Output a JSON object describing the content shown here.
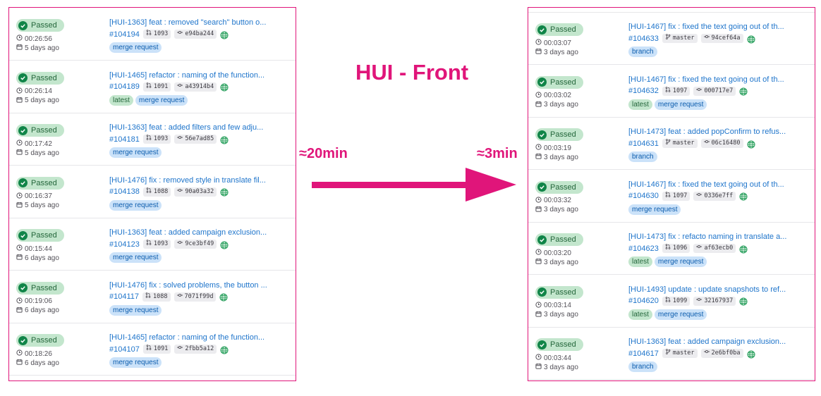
{
  "heading": "HUI - Front",
  "left_time_label": "≈20min",
  "right_time_label": "≈3min",
  "colors": {
    "accent": "#e0157a",
    "passed_bg": "#c3e6cd",
    "passed_text": "#24663b",
    "link": "#1f75cb"
  },
  "left_pipelines": [
    {
      "status": "Passed",
      "duration": "00:26:56",
      "age": "5 days ago",
      "title": "[HUI-1363] feat : removed \"search\" button o...",
      "id": "#104194",
      "ref_icon": "merge-request-icon",
      "ref": "1093",
      "commit": "e94ba244",
      "tags": [
        "merge request"
      ]
    },
    {
      "status": "Passed",
      "duration": "00:26:14",
      "age": "5 days ago",
      "title": "[HUI-1465] refactor : naming of the function...",
      "id": "#104189",
      "ref_icon": "merge-request-icon",
      "ref": "1091",
      "commit": "a43914b4",
      "tags": [
        "latest",
        "merge request"
      ]
    },
    {
      "status": "Passed",
      "duration": "00:17:42",
      "age": "5 days ago",
      "title": "[HUI-1363] feat : added filters and few adju...",
      "id": "#104181",
      "ref_icon": "merge-request-icon",
      "ref": "1093",
      "commit": "56e7ad85",
      "tags": [
        "merge request"
      ]
    },
    {
      "status": "Passed",
      "duration": "00:16:37",
      "age": "5 days ago",
      "title": "[HUI-1476] fix : removed style in translate fil...",
      "id": "#104138",
      "ref_icon": "merge-request-icon",
      "ref": "1088",
      "commit": "90a03a32",
      "tags": [
        "merge request"
      ]
    },
    {
      "status": "Passed",
      "duration": "00:15:44",
      "age": "6 days ago",
      "title": "[HUI-1363] feat : added campaign exclusion...",
      "id": "#104123",
      "ref_icon": "merge-request-icon",
      "ref": "1093",
      "commit": "9ce3bf49",
      "tags": [
        "merge request"
      ]
    },
    {
      "status": "Passed",
      "duration": "00:19:06",
      "age": "6 days ago",
      "title": "[HUI-1476] fix : solved problems, the button ...",
      "id": "#104117",
      "ref_icon": "merge-request-icon",
      "ref": "1088",
      "commit": "7071f99d",
      "tags": [
        "merge request"
      ]
    },
    {
      "status": "Passed",
      "duration": "00:18:26",
      "age": "6 days ago",
      "title": "[HUI-1465] refactor : naming of the function...",
      "id": "#104107",
      "ref_icon": "merge-request-icon",
      "ref": "1091",
      "commit": "2fbb5a12",
      "tags": [
        "merge request"
      ]
    }
  ],
  "right_pipelines": [
    {
      "status": "Passed",
      "duration": "00:03:07",
      "age": "3 days ago",
      "title": "[HUI-1467] fix : fixed the text going out of th...",
      "id": "#104633",
      "ref_icon": "branch-icon",
      "ref": "master",
      "commit": "94cef64a",
      "tags": [
        "branch"
      ]
    },
    {
      "status": "Passed",
      "duration": "00:03:02",
      "age": "3 days ago",
      "title": "[HUI-1467] fix : fixed the text going out of th...",
      "id": "#104632",
      "ref_icon": "merge-request-icon",
      "ref": "1097",
      "commit": "000717e7",
      "tags": [
        "latest",
        "merge request"
      ]
    },
    {
      "status": "Passed",
      "duration": "00:03:19",
      "age": "3 days ago",
      "title": "[HUI-1473] feat : added popConfirm to refus...",
      "id": "#104631",
      "ref_icon": "branch-icon",
      "ref": "master",
      "commit": "06c16480",
      "tags": [
        "branch"
      ]
    },
    {
      "status": "Passed",
      "duration": "00:03:32",
      "age": "3 days ago",
      "title": "[HUI-1467] fix : fixed the text going out of th...",
      "id": "#104630",
      "ref_icon": "merge-request-icon",
      "ref": "1097",
      "commit": "0336e7ff",
      "tags": [
        "merge request"
      ]
    },
    {
      "status": "Passed",
      "duration": "00:03:20",
      "age": "3 days ago",
      "title": "[HUI-1473] fix : refacto naming in translate a...",
      "id": "#104623",
      "ref_icon": "merge-request-icon",
      "ref": "1096",
      "commit": "af63ecb0",
      "tags": [
        "latest",
        "merge request"
      ]
    },
    {
      "status": "Passed",
      "duration": "00:03:14",
      "age": "3 days ago",
      "title": "[HUI-1493] update : update snapshots to ref...",
      "id": "#104620",
      "ref_icon": "merge-request-icon",
      "ref": "1099",
      "commit": "32167937",
      "tags": [
        "latest",
        "merge request"
      ]
    },
    {
      "status": "Passed",
      "duration": "00:03:44",
      "age": "3 days ago",
      "title": "[HUI-1363] feat : added campaign exclusion...",
      "id": "#104617",
      "ref_icon": "branch-icon",
      "ref": "master",
      "commit": "2e6bf0ba",
      "tags": [
        "branch"
      ]
    }
  ]
}
